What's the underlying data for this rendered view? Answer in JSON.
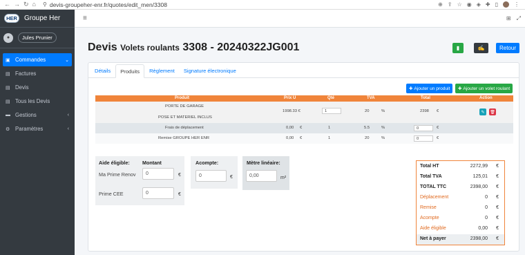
{
  "browser": {
    "url": "devis-groupeher-enr.fr/quotes/edit_men/3308"
  },
  "sidebar": {
    "brand_logo": "HER",
    "brand_name": "Groupe Her",
    "user_name": "Jules Prunier",
    "items": [
      {
        "label": "Commandes",
        "icon": "dashboard-icon",
        "active": true,
        "chevron": "‹"
      },
      {
        "label": "Factures",
        "icon": "file-icon"
      },
      {
        "label": "Devis",
        "icon": "file-icon"
      },
      {
        "label": "Tous les Devis",
        "icon": "file-icon"
      },
      {
        "label": "Gestions",
        "icon": "card-icon",
        "chevron": "‹"
      },
      {
        "label": "Paramètres",
        "icon": "gear-icon",
        "chevron": "‹"
      }
    ]
  },
  "header": {
    "title_main": "Devis",
    "title_sub": "Volets roulants",
    "title_ref": "3308 - 20240322JG001",
    "back_label": "Retour"
  },
  "tabs": [
    "Détails",
    "Produits",
    "Règlement",
    "Signature électronique"
  ],
  "actions": {
    "add_product": "Ajouter un produit",
    "add_volet": "Ajouter un volet roulant"
  },
  "table": {
    "headers": [
      "Produit",
      "Prix U",
      "Qté",
      "TVA",
      "Total",
      "Action"
    ],
    "rows": [
      {
        "product_line1": "PORTE DE GARAGE",
        "product_line2": "POSE ET MATERIEL INCLUS",
        "price": "1998.33 €",
        "qty": "1",
        "tva": "20",
        "pct": "%",
        "total": "2398",
        "cur": "€"
      },
      {
        "product": "Frais de déplacement",
        "price": "0,00",
        "cur1": "€",
        "qty": "1",
        "tva": "5.5",
        "pct": "%",
        "total": "0",
        "cur": "€"
      },
      {
        "product": "Remise GROUPE HER ENR",
        "price": "0,00",
        "cur1": "€",
        "qty": "1",
        "tva": "20",
        "pct": "%",
        "total": "0",
        "cur": "€"
      }
    ]
  },
  "aide": {
    "title": "Aide éligible:",
    "amount_header": "Montant",
    "prime_renov_label": "Ma Prime Renov",
    "prime_renov_value": "0",
    "prime_cee_label": "Prime CEE",
    "prime_cee_value": "0",
    "unit": "€"
  },
  "acompte": {
    "title": "Acompte:",
    "value": "0",
    "unit": "€"
  },
  "metre": {
    "title": "Mètre linéaire:",
    "value": "0,00",
    "unit": "m²"
  },
  "totals": [
    {
      "label": "Total HT",
      "value": "2272,99",
      "cur": "€",
      "style": "bold"
    },
    {
      "label": "Total TVA",
      "value": "125,01",
      "cur": "€",
      "style": "bold"
    },
    {
      "label": "TOTAL TTC",
      "value": "2398,00",
      "cur": "€",
      "style": "bold"
    },
    {
      "label": "Déplacement",
      "value": "0",
      "cur": "€",
      "style": "orange"
    },
    {
      "label": "Remise",
      "value": "0",
      "cur": "€",
      "style": "orange"
    },
    {
      "label": "Acompte",
      "value": "0",
      "cur": "€",
      "style": "orange"
    },
    {
      "label": "Aide éligible",
      "value": "0,00",
      "cur": "€",
      "style": "orange"
    },
    {
      "label": "Net à payer",
      "value": "2398,00",
      "cur": "€",
      "style": "bold"
    }
  ],
  "colors": {
    "accent": "#007bff",
    "orange": "#f0843a",
    "sidebar": "#343a40",
    "green": "#28a745"
  }
}
